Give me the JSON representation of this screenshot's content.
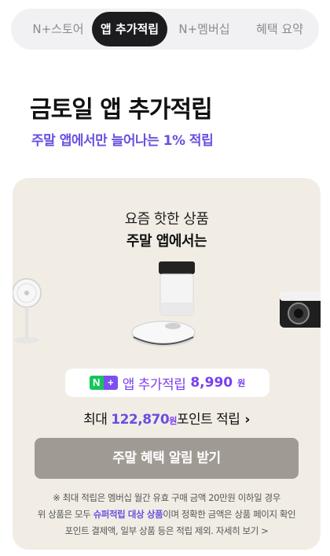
{
  "tabs": [
    {
      "label": "N+스토어",
      "active": false
    },
    {
      "label": "앱 추가적립",
      "active": true
    },
    {
      "label": "N+멤버십",
      "active": false
    },
    {
      "label": "혜택 요약",
      "active": false
    }
  ],
  "header": {
    "title": "금토일 앱 추가적립",
    "subtitle": "주말 앱에서만 늘어나는 1% 적립"
  },
  "card": {
    "line1": "요즘 핫한 상품",
    "line2": "주말 앱에서는",
    "badge_n": "N",
    "badge_plus": "+",
    "pill_label": "앱 추가적립",
    "pill_amount": "8,990",
    "won": "원",
    "max_prefix": "최대",
    "max_amount": "122,870",
    "max_suffix": "포인트 적립",
    "max_chevron": "›",
    "cta_label": "주말 혜택 알림 받기",
    "notice_1": "※ 최대 적립은 멤버십 월간 유효 구매 금액 20만원 이하일 경우",
    "notice_2a": "위 상품은 모두 ",
    "notice_2_highlight": "슈퍼적립 대상 상품",
    "notice_2b": "이며 정확한 금액은 상품 페이지 확인",
    "notice_3": "포인트 결제액, 일부 상품 등은 적립 제외. 자세히 보기 >"
  },
  "colors": {
    "accent": "#6a4fe0",
    "card_bg": "#f1ede5",
    "cta_bg": "#a09a94",
    "naver_green": "#19c45d"
  }
}
